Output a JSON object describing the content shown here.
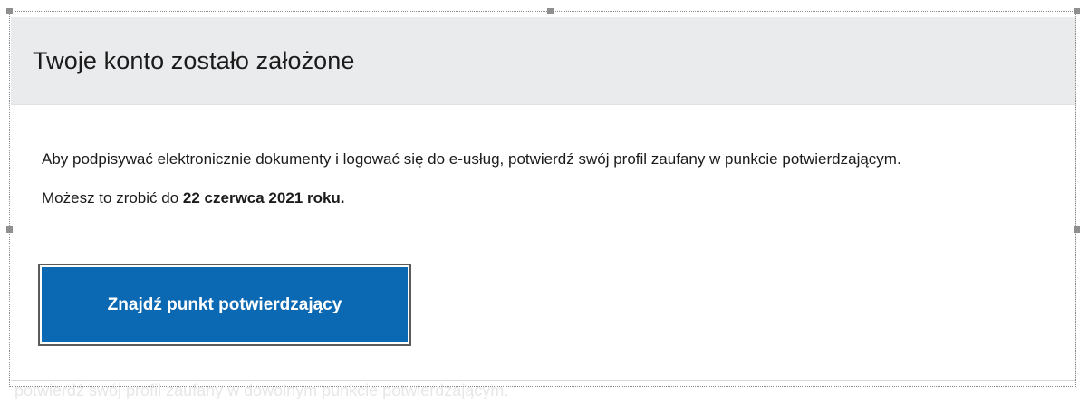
{
  "dialog": {
    "title": "Twoje konto zostało założone",
    "paragraph1": "Aby podpisywać elektronicznie dokumenty i logować się do e-usług, potwierdź swój profil zaufany w punkcie potwierdzającym.",
    "paragraph2_prefix": "Możesz to zrobić do ",
    "paragraph2_date": "22 czerwca 2021 roku.",
    "button_label": "Znajdź punkt potwierdzający"
  },
  "background": {
    "text": "potwierdź swój profil zaufany w dowolnym punkcie potwierdzającym."
  },
  "colors": {
    "button": "#0b68b3",
    "header_bg": "#e9ebed"
  }
}
